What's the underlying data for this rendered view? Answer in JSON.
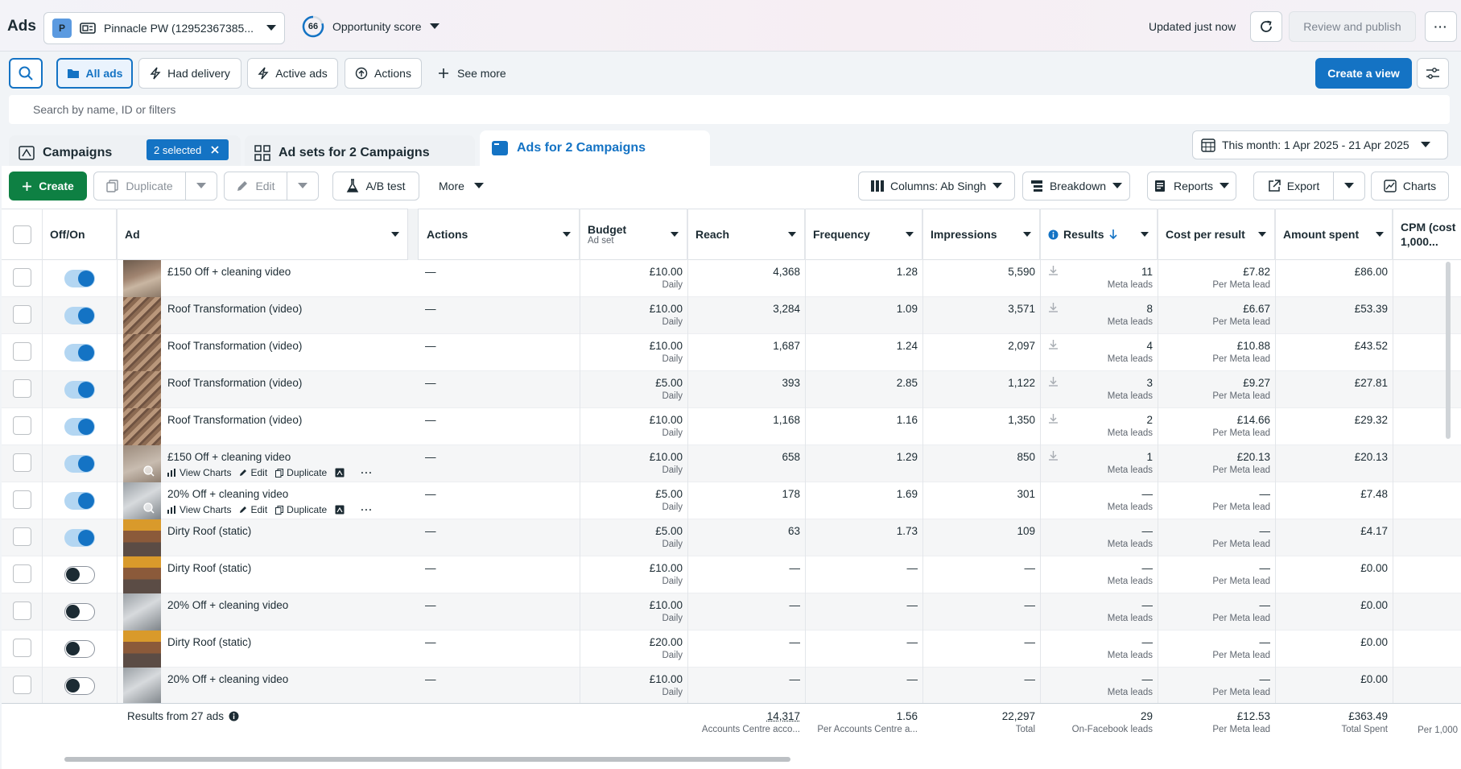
{
  "header": {
    "title": "Ads",
    "account_initial": "P",
    "account_name": "Pinnacle PW (12952367385...",
    "opportunity_score": "66",
    "opportunity_label": "Opportunity score",
    "updated": "Updated just now",
    "review_publish": "Review and publish",
    "more": "···"
  },
  "filters": {
    "all_ads": "All ads",
    "had_delivery": "Had delivery",
    "active_ads": "Active ads",
    "actions": "Actions",
    "see_more": "See more",
    "create_view": "Create a view"
  },
  "search": {
    "placeholder": "Search by name, ID or filters"
  },
  "tabs": {
    "campaigns": "Campaigns",
    "selected": "2 selected",
    "adsets": "Ad sets for 2 Campaigns",
    "ads": "Ads for 2 Campaigns",
    "date_range": "This month: 1 Apr 2025 - 21 Apr 2025"
  },
  "toolbar": {
    "create": "Create",
    "duplicate": "Duplicate",
    "edit": "Edit",
    "ab_test": "A/B test",
    "more": "More",
    "columns": "Columns: Ab Singh",
    "breakdown": "Breakdown",
    "reports": "Reports",
    "export": "Export",
    "charts": "Charts"
  },
  "columns": {
    "off_on": "Off/On",
    "ad": "Ad",
    "actions": "Actions",
    "budget": "Budget",
    "budget_sub": "Ad set",
    "reach": "Reach",
    "frequency": "Frequency",
    "impressions": "Impressions",
    "results": "Results",
    "cost_per_result": "Cost per result",
    "amount_spent": "Amount spent",
    "cpm_line1": "CPM (cost",
    "cpm_line2": "1,000..."
  },
  "rows": [
    {
      "name": "£150 Off + cleaning video",
      "on": true,
      "actions": "—",
      "budget": "£10.00",
      "budget_sub": "Daily",
      "reach": "4,368",
      "frequency": "1.28",
      "impressions": "5,590",
      "results": "11",
      "results_sub": "Meta leads",
      "cpr": "£7.82",
      "cpr_sub": "Per Meta lead",
      "spent": "£86.00",
      "thumb": "roof1"
    },
    {
      "name": "Roof Transformation (video)",
      "on": true,
      "actions": "—",
      "budget": "£10.00",
      "budget_sub": "Daily",
      "reach": "3,284",
      "frequency": "1.09",
      "impressions": "3,571",
      "results": "8",
      "results_sub": "Meta leads",
      "cpr": "£6.67",
      "cpr_sub": "Per Meta lead",
      "spent": "£53.39",
      "thumb": "roof2"
    },
    {
      "name": "Roof Transformation (video)",
      "on": true,
      "actions": "—",
      "budget": "£10.00",
      "budget_sub": "Daily",
      "reach": "1,687",
      "frequency": "1.24",
      "impressions": "2,097",
      "results": "4",
      "results_sub": "Meta leads",
      "cpr": "£10.88",
      "cpr_sub": "Per Meta lead",
      "spent": "£43.52",
      "thumb": "roof2"
    },
    {
      "name": "Roof Transformation (video)",
      "on": true,
      "actions": "—",
      "budget": "£5.00",
      "budget_sub": "Daily",
      "reach": "393",
      "frequency": "2.85",
      "impressions": "1,122",
      "results": "3",
      "results_sub": "Meta leads",
      "cpr": "£9.27",
      "cpr_sub": "Per Meta lead",
      "spent": "£27.81",
      "thumb": "roof2"
    },
    {
      "name": "Roof Transformation (video)",
      "on": true,
      "actions": "—",
      "budget": "£10.00",
      "budget_sub": "Daily",
      "reach": "1,168",
      "frequency": "1.16",
      "impressions": "1,350",
      "results": "2",
      "results_sub": "Meta leads",
      "cpr": "£14.66",
      "cpr_sub": "Per Meta lead",
      "spent": "£29.32",
      "thumb": "roof2"
    },
    {
      "name": "£150 Off + cleaning video",
      "on": true,
      "actions": "—",
      "budget": "£10.00",
      "budget_sub": "Daily",
      "reach": "658",
      "frequency": "1.29",
      "impressions": "850",
      "results": "1",
      "results_sub": "Meta leads",
      "cpr": "£20.13",
      "cpr_sub": "Per Meta lead",
      "spent": "£20.13",
      "thumb": "roof3",
      "hover": true
    },
    {
      "name": "20% Off + cleaning video",
      "on": true,
      "actions": "—",
      "budget": "£5.00",
      "budget_sub": "Daily",
      "reach": "178",
      "frequency": "1.69",
      "impressions": "301",
      "results": "—",
      "results_sub": "Meta leads",
      "cpr": "—",
      "cpr_sub": "Per Meta lead",
      "spent": "£7.48",
      "thumb": "grey",
      "hover": true
    },
    {
      "name": "Dirty Roof (static)",
      "on": true,
      "actions": "—",
      "budget": "£5.00",
      "budget_sub": "Daily",
      "reach": "63",
      "frequency": "1.73",
      "impressions": "109",
      "results": "—",
      "results_sub": "Meta leads",
      "cpr": "—",
      "cpr_sub": "Per Meta lead",
      "spent": "£4.17",
      "thumb": "dirty"
    },
    {
      "name": "Dirty Roof (static)",
      "on": false,
      "actions": "—",
      "budget": "£10.00",
      "budget_sub": "Daily",
      "reach": "—",
      "frequency": "—",
      "impressions": "—",
      "results": "—",
      "results_sub": "Meta leads",
      "cpr": "—",
      "cpr_sub": "Per Meta lead",
      "spent": "£0.00",
      "thumb": "dirty"
    },
    {
      "name": "20% Off + cleaning video",
      "on": false,
      "actions": "—",
      "budget": "£10.00",
      "budget_sub": "Daily",
      "reach": "—",
      "frequency": "—",
      "impressions": "—",
      "results": "—",
      "results_sub": "Meta leads",
      "cpr": "—",
      "cpr_sub": "Per Meta lead",
      "spent": "£0.00",
      "thumb": "grey"
    },
    {
      "name": "Dirty Roof (static)",
      "on": false,
      "actions": "—",
      "budget": "£20.00",
      "budget_sub": "Daily",
      "reach": "—",
      "frequency": "—",
      "impressions": "—",
      "results": "—",
      "results_sub": "Meta leads",
      "cpr": "—",
      "cpr_sub": "Per Meta lead",
      "spent": "£0.00",
      "thumb": "dirty"
    },
    {
      "name": "20% Off + cleaning video",
      "on": false,
      "actions": "—",
      "budget": "£10.00",
      "budget_sub": "Daily",
      "reach": "—",
      "frequency": "—",
      "impressions": "—",
      "results": "—",
      "results_sub": "Meta leads",
      "cpr": "—",
      "cpr_sub": "Per Meta lead",
      "spent": "£0.00",
      "thumb": "grey"
    }
  ],
  "row_actions": {
    "view_charts": "View Charts",
    "edit": "Edit",
    "duplicate": "Duplicate"
  },
  "totals": {
    "label": "Results from 27 ads",
    "reach": "14,317",
    "reach_sub": "Accounts Centre acco...",
    "frequency": "1.56",
    "frequency_sub": "Per Accounts Centre a...",
    "impressions": "22,297",
    "impressions_sub": "Total",
    "results": "29",
    "results_sub": "On-Facebook leads",
    "cpr": "£12.53",
    "cpr_sub": "Per Meta lead",
    "spent": "£363.49",
    "spent_sub": "Total Spent",
    "cpm_sub": "Per 1,000"
  }
}
